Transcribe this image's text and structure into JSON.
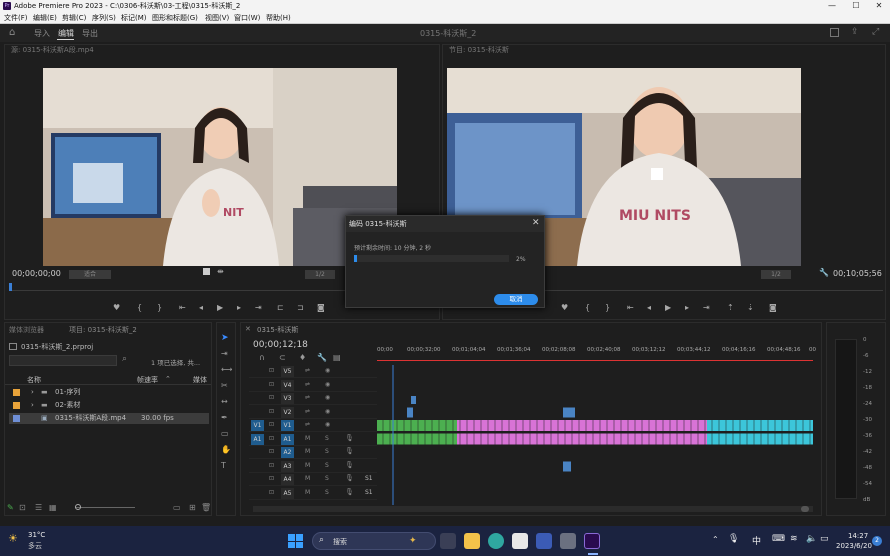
{
  "app": {
    "logo": "Pr",
    "title": "Adobe Premiere Pro 2023 - C:\\0306-科沃斯\\03-工程\\0315-科沃斯_2"
  },
  "window_controls": {
    "minimize": "—",
    "maximize": "☐",
    "close": "✕"
  },
  "menu": [
    "文件(F)",
    "编辑(E)",
    "剪辑(C)",
    "序列(S)",
    "标记(M)",
    "图形和标题(G)",
    "视图(V)",
    "窗口(W)",
    "帮助(H)"
  ],
  "workspace": {
    "tabs": [
      "导入",
      "编辑",
      "导出"
    ],
    "active_tab": "编辑",
    "center_title": "0315-科沃斯_2"
  },
  "source_monitor": {
    "header": "源: 0315-科沃斯A段.mp4",
    "timecode": "00;00;00;00",
    "fit": "适合",
    "ratio": "1/2"
  },
  "program_monitor": {
    "header": "节目: 0315-科沃斯",
    "timecode_end": "00;10;05;56",
    "ratio": "1/2"
  },
  "dialog": {
    "title": "编码 0315-科沃斯",
    "message": "预计剩余时间: 10 分钟, 2 秒",
    "progress_percent": 2,
    "progress_label": "2%",
    "cancel_label": "取消",
    "close": "✕"
  },
  "project_panel": {
    "tabs": [
      "媒体浏览器",
      "项目: 0315-科沃斯_2"
    ],
    "project_file": "0315-科沃斯_2.prproj",
    "selection_info": "1 项已选择, 共...",
    "columns": [
      "名称",
      "帧速率",
      "媒体"
    ],
    "items": [
      {
        "name": "01-序列",
        "type": "bin",
        "color": "#e8a33a",
        "fps": ""
      },
      {
        "name": "02-素材",
        "type": "bin",
        "color": "#e8a33a",
        "fps": ""
      },
      {
        "name": "0315-科沃斯A段.mp4",
        "type": "clip",
        "color": "#6f8fd6",
        "fps": "30.00 fps"
      }
    ]
  },
  "timeline": {
    "tab": "0315-科沃斯",
    "timecode": "00;00;12;18",
    "ruler": [
      "00;00",
      "00;00;32;00",
      "00;01;04;04",
      "00;01;36;04",
      "00;02;08;08",
      "00;02;40;08",
      "00;03;12;12",
      "00;03;44;12",
      "00;04;16;16",
      "00;04;48;16",
      "00"
    ],
    "video_tracks": [
      "V5",
      "V4",
      "V3",
      "V2",
      "V1"
    ],
    "audio_tracks": [
      "A1",
      "A2",
      "A3",
      "A4",
      "A5"
    ],
    "source_v": "V1",
    "source_a": "A1",
    "solo_labels": [
      "S1",
      "S1"
    ],
    "colors": {
      "video": "#4caf50",
      "pink": "#d873d6",
      "cyan": "#3cc6da",
      "blue": "#4a84c4",
      "playhead": "#3a7fd5"
    }
  },
  "meter": {
    "ticks": [
      "0",
      "-6",
      "-12",
      "-18",
      "-24",
      "-30",
      "-36",
      "-42",
      "-48",
      "-54",
      "dB"
    ]
  },
  "taskbar": {
    "weather_temp": "31°C",
    "weather_desc": "多云",
    "search": "搜索",
    "ime": "中",
    "time": "14:27",
    "date": "2023/6/20",
    "notification_count": "2"
  }
}
